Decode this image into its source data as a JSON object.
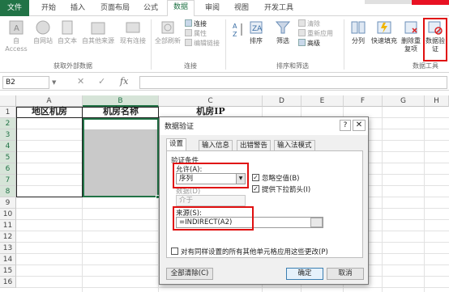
{
  "tabs": {
    "file": "文件",
    "start": "开始",
    "insert": "插入",
    "layout": "页面布局",
    "formula": "公式",
    "data": "数据",
    "review": "审阅",
    "view": "视图",
    "developer": "开发工具"
  },
  "ribbon": {
    "external": {
      "access": "自 Access",
      "web": "自网站",
      "text": "自文本",
      "other": "自其他来源",
      "existing": "现有连接",
      "label": "获取外部数据"
    },
    "connections": {
      "refresh": "全部刷新",
      "connect": "连接",
      "props": "属性",
      "editlinks": "编辑链接",
      "label": "连接"
    },
    "sort": {
      "sort": "排序",
      "filter": "筛选",
      "clear": "清除",
      "reapply": "重新应用",
      "advanced": "高级",
      "label": "排序和筛选"
    },
    "tools": {
      "split": "分列",
      "flash": "快速填充",
      "dedupe": "删除重复项",
      "validate": "数据验证",
      "label": "数据工具"
    }
  },
  "formula_bar": {
    "name_box": "B2",
    "fx": "fx",
    "formula": ""
  },
  "sheet": {
    "columns": [
      "A",
      "B",
      "C",
      "D",
      "E",
      "F",
      "G",
      "H"
    ],
    "rows": [
      "1",
      "2",
      "3",
      "4",
      "5",
      "6",
      "7",
      "8",
      "9",
      "10",
      "11",
      "12",
      "13",
      "14",
      "15",
      "16"
    ],
    "header_cells": [
      "地区机房",
      "机房名称",
      "机房IP"
    ]
  },
  "dialog": {
    "title": "数据验证",
    "tabs": [
      "设置",
      "输入信息",
      "出错警告",
      "输入法模式"
    ],
    "criteria_label": "验证条件",
    "allow_label": "允许(A):",
    "allow_value": "序列",
    "ignore_blank": "忽略空值(B)",
    "dropdown": "提供下拉箭头(I)",
    "data_label": "数据(D)",
    "data_value": "介于",
    "source_label": "来源(S):",
    "source_value": "=INDIRECT(A2)",
    "apply_all": "对有同样设置的所有其他单元格应用这些更改(P)",
    "clear_all": "全部清除(C)",
    "ok": "确定",
    "cancel": "取消"
  },
  "colors": {
    "excel_green": "#217346",
    "highlight_red": "#e01010",
    "selection_fill": "#c9c9c9"
  }
}
